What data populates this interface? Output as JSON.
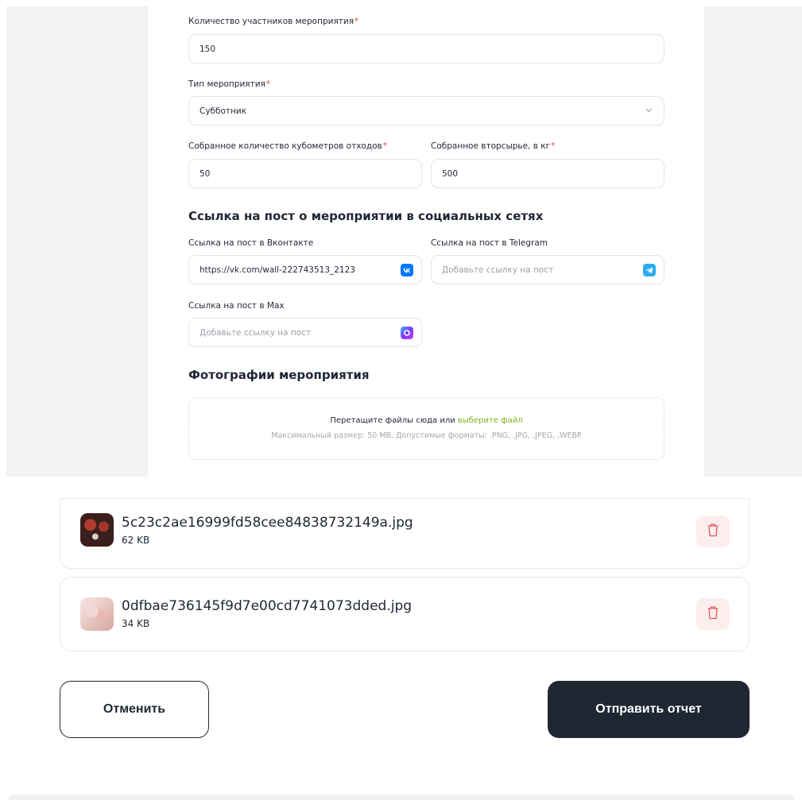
{
  "form": {
    "participants": {
      "label": "Количество участников мероприятия",
      "value": "150"
    },
    "event_type": {
      "label": "Тип мероприятия",
      "value": "Субботник"
    },
    "waste_volume": {
      "label": "Собранное количество кубометров отходов",
      "value": "50"
    },
    "recyclables": {
      "label": "Собранное вторсырье, в кг",
      "value": "500"
    },
    "required_mark": "*"
  },
  "social": {
    "heading": "Ссылка на пост о мероприятии в социальных сетях",
    "vk": {
      "label": "Ссылка на пост в Вконтакте",
      "value": "https://vk.com/wall-222743513_2123",
      "icon": "vk-icon"
    },
    "telegram": {
      "label": "Ссылка на пост в Telegram",
      "placeholder": "Добавьте ссылку на пост",
      "icon": "telegram-icon"
    },
    "max": {
      "label": "Ссылка на пост в Max",
      "placeholder": "Добавьте ссылку на пост",
      "icon": "max-icon"
    }
  },
  "photos": {
    "heading": "Фотографии мероприятия",
    "drop_text": "Перетащите файлы сюда или ",
    "drop_link": "выберите файл",
    "drop_hint": "Максимальный размер: 50 MB, Допустимые форматы: .PNG, .JPG, .JPEG, .WEBP"
  },
  "files": [
    {
      "name": "5c23c2ae16999fd58cee84838732149a.jpg",
      "size": "62 KB"
    },
    {
      "name": "0dfbae736145f9d7e00cd7741073dded.jpg",
      "size": "34 KB"
    }
  ],
  "actions": {
    "cancel": "Отменить",
    "submit": "Отправить отчет"
  },
  "colors": {
    "accent": "#1f2733",
    "link": "#7fb319",
    "required": "#e0483c",
    "delete_bg": "#fdeeee",
    "delete_icon": "#e05a5a",
    "vk": "#0077ff",
    "telegram": "#2aabee"
  }
}
